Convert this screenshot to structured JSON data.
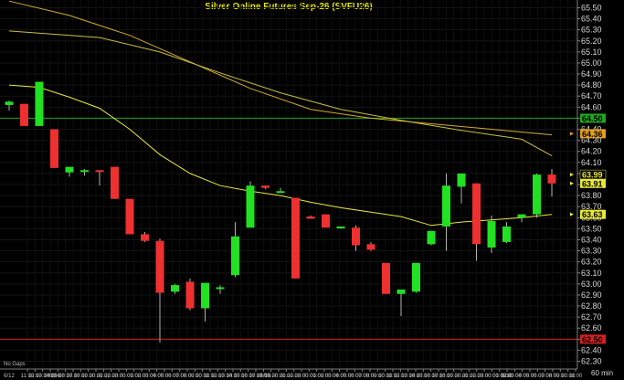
{
  "chart_data": {
    "type": "candlestick",
    "title": "Silver  Online  Futures  Sep-26  (SVFU26)",
    "interval_label": "60  min",
    "note": "No Gaps",
    "ylim": [
      62.23,
      65.57
    ],
    "yticks": [
      "65.50",
      "65.40",
      "65.30",
      "65.20",
      "65.10",
      "65.00",
      "64.90",
      "64.80",
      "64.70",
      "64.60",
      "64.50",
      "64.40",
      "64.30",
      "64.20",
      "64.10",
      "64.00",
      "63.90",
      "63.80",
      "63.70",
      "63.60",
      "63.50",
      "63.40",
      "63.30",
      "63.20",
      "63.10",
      "63.00",
      "62.90",
      "62.80",
      "62.70",
      "62.60",
      "62.50",
      "62.40",
      "62.30"
    ],
    "date_labels": [
      {
        "text": "6/12",
        "index": 0
      },
      {
        "text": "6/14",
        "index": 3
      },
      {
        "text": "6/15",
        "index": 17
      },
      {
        "text": "6/16",
        "index": 33
      }
    ],
    "xticks": [
      "11:00",
      "12:00",
      "13:00",
      "14:00",
      "15:00",
      "16:00",
      "17:00",
      "18:00",
      "19:00",
      "20:00",
      "21:00",
      "22:00",
      "23:00",
      "00:00",
      "01:00",
      "02:00",
      "03:00",
      "04:00",
      "05:00",
      "06:00",
      "07:00",
      "08:00",
      "09:00",
      "10:00",
      "11:00",
      "12:00",
      "13:00",
      "14:00",
      "15:00",
      "16:00",
      "17:00",
      "18:00",
      "19:00",
      "20:00",
      "21:00",
      "22:00",
      "23:00",
      "00:00",
      "01:00",
      "02:00",
      "03:00",
      "04:00",
      "05:00",
      "06:00",
      "07:00",
      "08:00",
      "09:00",
      "10:00",
      "11:00",
      "12:00",
      "13:00",
      "14:00",
      "15:00",
      "16:00",
      "17:00",
      "18:00",
      "19:00",
      "20:00",
      "21:00",
      "22:00",
      "23:00",
      "00:00",
      "01:00",
      "02:00",
      "03:00",
      "04:00",
      "05:00",
      "06:00",
      "07:00",
      "08:00",
      "09:00",
      "10:00",
      "11:00"
    ],
    "candles": [
      {
        "o": 64.62,
        "h": 64.66,
        "l": 64.57,
        "c": 64.65
      },
      {
        "o": 64.63,
        "h": 64.63,
        "l": 64.43,
        "c": 64.43
      },
      {
        "o": 64.43,
        "h": 64.83,
        "l": 64.43,
        "c": 64.83
      },
      {
        "o": 64.4,
        "h": 64.4,
        "l": 64.05,
        "c": 64.05
      },
      {
        "o": 64.01,
        "h": 64.06,
        "l": 63.97,
        "c": 64.06
      },
      {
        "o": 64.03,
        "h": 64.04,
        "l": 63.98,
        "c": 64.03
      },
      {
        "o": 64.03,
        "h": 64.03,
        "l": 63.89,
        "c": 64.02
      },
      {
        "o": 64.06,
        "h": 64.06,
        "l": 63.77,
        "c": 63.77
      },
      {
        "o": 63.77,
        "h": 63.77,
        "l": 63.45,
        "c": 63.45
      },
      {
        "o": 63.45,
        "h": 63.47,
        "l": 63.38,
        "c": 63.39
      },
      {
        "o": 63.39,
        "h": 63.41,
        "l": 62.47,
        "c": 62.92
      },
      {
        "o": 62.93,
        "h": 63.0,
        "l": 62.91,
        "c": 62.99
      },
      {
        "o": 63.02,
        "h": 63.05,
        "l": 62.76,
        "c": 62.78
      },
      {
        "o": 62.78,
        "h": 63.01,
        "l": 62.66,
        "c": 63.01
      },
      {
        "o": 62.96,
        "h": 62.99,
        "l": 62.91,
        "c": 62.97
      },
      {
        "o": 63.08,
        "h": 63.56,
        "l": 63.06,
        "c": 63.43
      },
      {
        "o": 63.51,
        "h": 63.93,
        "l": 63.51,
        "c": 63.89
      },
      {
        "o": 63.89,
        "h": 63.89,
        "l": 63.86,
        "c": 63.87
      },
      {
        "o": 63.84,
        "h": 63.87,
        "l": 63.83,
        "c": 63.84
      },
      {
        "o": 63.78,
        "h": 63.78,
        "l": 63.05,
        "c": 63.05
      },
      {
        "o": 63.61,
        "h": 63.62,
        "l": 63.59,
        "c": 63.59
      },
      {
        "o": 63.63,
        "h": 63.63,
        "l": 63.51,
        "c": 63.51
      },
      {
        "o": 63.51,
        "h": 63.52,
        "l": 63.5,
        "c": 63.52
      },
      {
        "o": 63.51,
        "h": 63.53,
        "l": 63.3,
        "c": 63.35
      },
      {
        "o": 63.36,
        "h": 63.38,
        "l": 63.3,
        "c": 63.31
      },
      {
        "o": 63.19,
        "h": 63.19,
        "l": 62.91,
        "c": 62.91
      },
      {
        "o": 62.91,
        "h": 62.94,
        "l": 62.71,
        "c": 62.95
      },
      {
        "o": 62.93,
        "h": 63.19,
        "l": 62.92,
        "c": 63.19
      },
      {
        "o": 63.36,
        "h": 63.48,
        "l": 63.35,
        "c": 63.48
      },
      {
        "o": 63.52,
        "h": 64.0,
        "l": 63.3,
        "c": 63.89
      },
      {
        "o": 63.88,
        "h": 63.97,
        "l": 63.73,
        "c": 64.0
      },
      {
        "o": 63.91,
        "h": 63.91,
        "l": 63.21,
        "c": 63.36
      },
      {
        "o": 63.33,
        "h": 63.62,
        "l": 63.28,
        "c": 63.57
      },
      {
        "o": 63.38,
        "h": 63.56,
        "l": 63.37,
        "c": 63.52
      },
      {
        "o": 63.6,
        "h": 63.63,
        "l": 63.56,
        "c": 63.63
      },
      {
        "o": 63.63,
        "h": 64.0,
        "l": 63.6,
        "c": 63.99
      },
      {
        "o": 63.99,
        "h": 64.04,
        "l": 63.79,
        "c": 63.91
      }
    ],
    "series": [
      {
        "color": "#e8e838",
        "points": [
          [
            0,
            64.8
          ],
          [
            2,
            64.78
          ],
          [
            4,
            64.69
          ],
          [
            6,
            64.59
          ],
          [
            8,
            64.4
          ],
          [
            10,
            64.17
          ],
          [
            12,
            64.0
          ],
          [
            14,
            63.89
          ],
          [
            16,
            63.84
          ],
          [
            18,
            63.8
          ],
          [
            20,
            63.74
          ],
          [
            22,
            63.69
          ],
          [
            24,
            63.65
          ],
          [
            26,
            63.61
          ],
          [
            28,
            63.53
          ],
          [
            30,
            63.56
          ],
          [
            32,
            63.58
          ],
          [
            34,
            63.6
          ],
          [
            36,
            63.63
          ]
        ]
      },
      {
        "color": "#d4ac2c",
        "points": [
          [
            0,
            65.56
          ],
          [
            4,
            65.43
          ],
          [
            8,
            65.25
          ],
          [
            12,
            65.01
          ],
          [
            16,
            64.77
          ],
          [
            20,
            64.58
          ],
          [
            24,
            64.5
          ],
          [
            28,
            64.45
          ],
          [
            32,
            64.4
          ],
          [
            36,
            64.35
          ]
        ]
      },
      {
        "color": "#c8c040",
        "points": [
          [
            0,
            65.29
          ],
          [
            6,
            65.23
          ],
          [
            10,
            65.1
          ],
          [
            14,
            64.91
          ],
          [
            18,
            64.73
          ],
          [
            22,
            64.58
          ],
          [
            26,
            64.48
          ],
          [
            30,
            64.39
          ],
          [
            34,
            64.31
          ],
          [
            36,
            64.16
          ]
        ]
      }
    ],
    "hlines": [
      {
        "value": 64.5,
        "color": "#1fa51f",
        "label": "64.50"
      },
      {
        "value": 62.5,
        "color": "#d42020",
        "label": "62.50"
      }
    ],
    "tags": [
      {
        "value": 64.36,
        "label": "64.36",
        "bg": "#e0a020",
        "fg": "#000000"
      },
      {
        "value": 63.99,
        "label": "63.99",
        "bg": "#000000",
        "fg": "#e8e838"
      },
      {
        "value": 63.91,
        "label": "63.91",
        "bg": "#e8e838",
        "fg": "#000000"
      },
      {
        "value": 63.63,
        "label": "63.63",
        "bg": "#e8e838",
        "fg": "#000000"
      }
    ],
    "colors": {
      "up": "#22e022",
      "down": "#ee3030",
      "background": "#000000",
      "axis_text": "#d8d8d8"
    }
  }
}
